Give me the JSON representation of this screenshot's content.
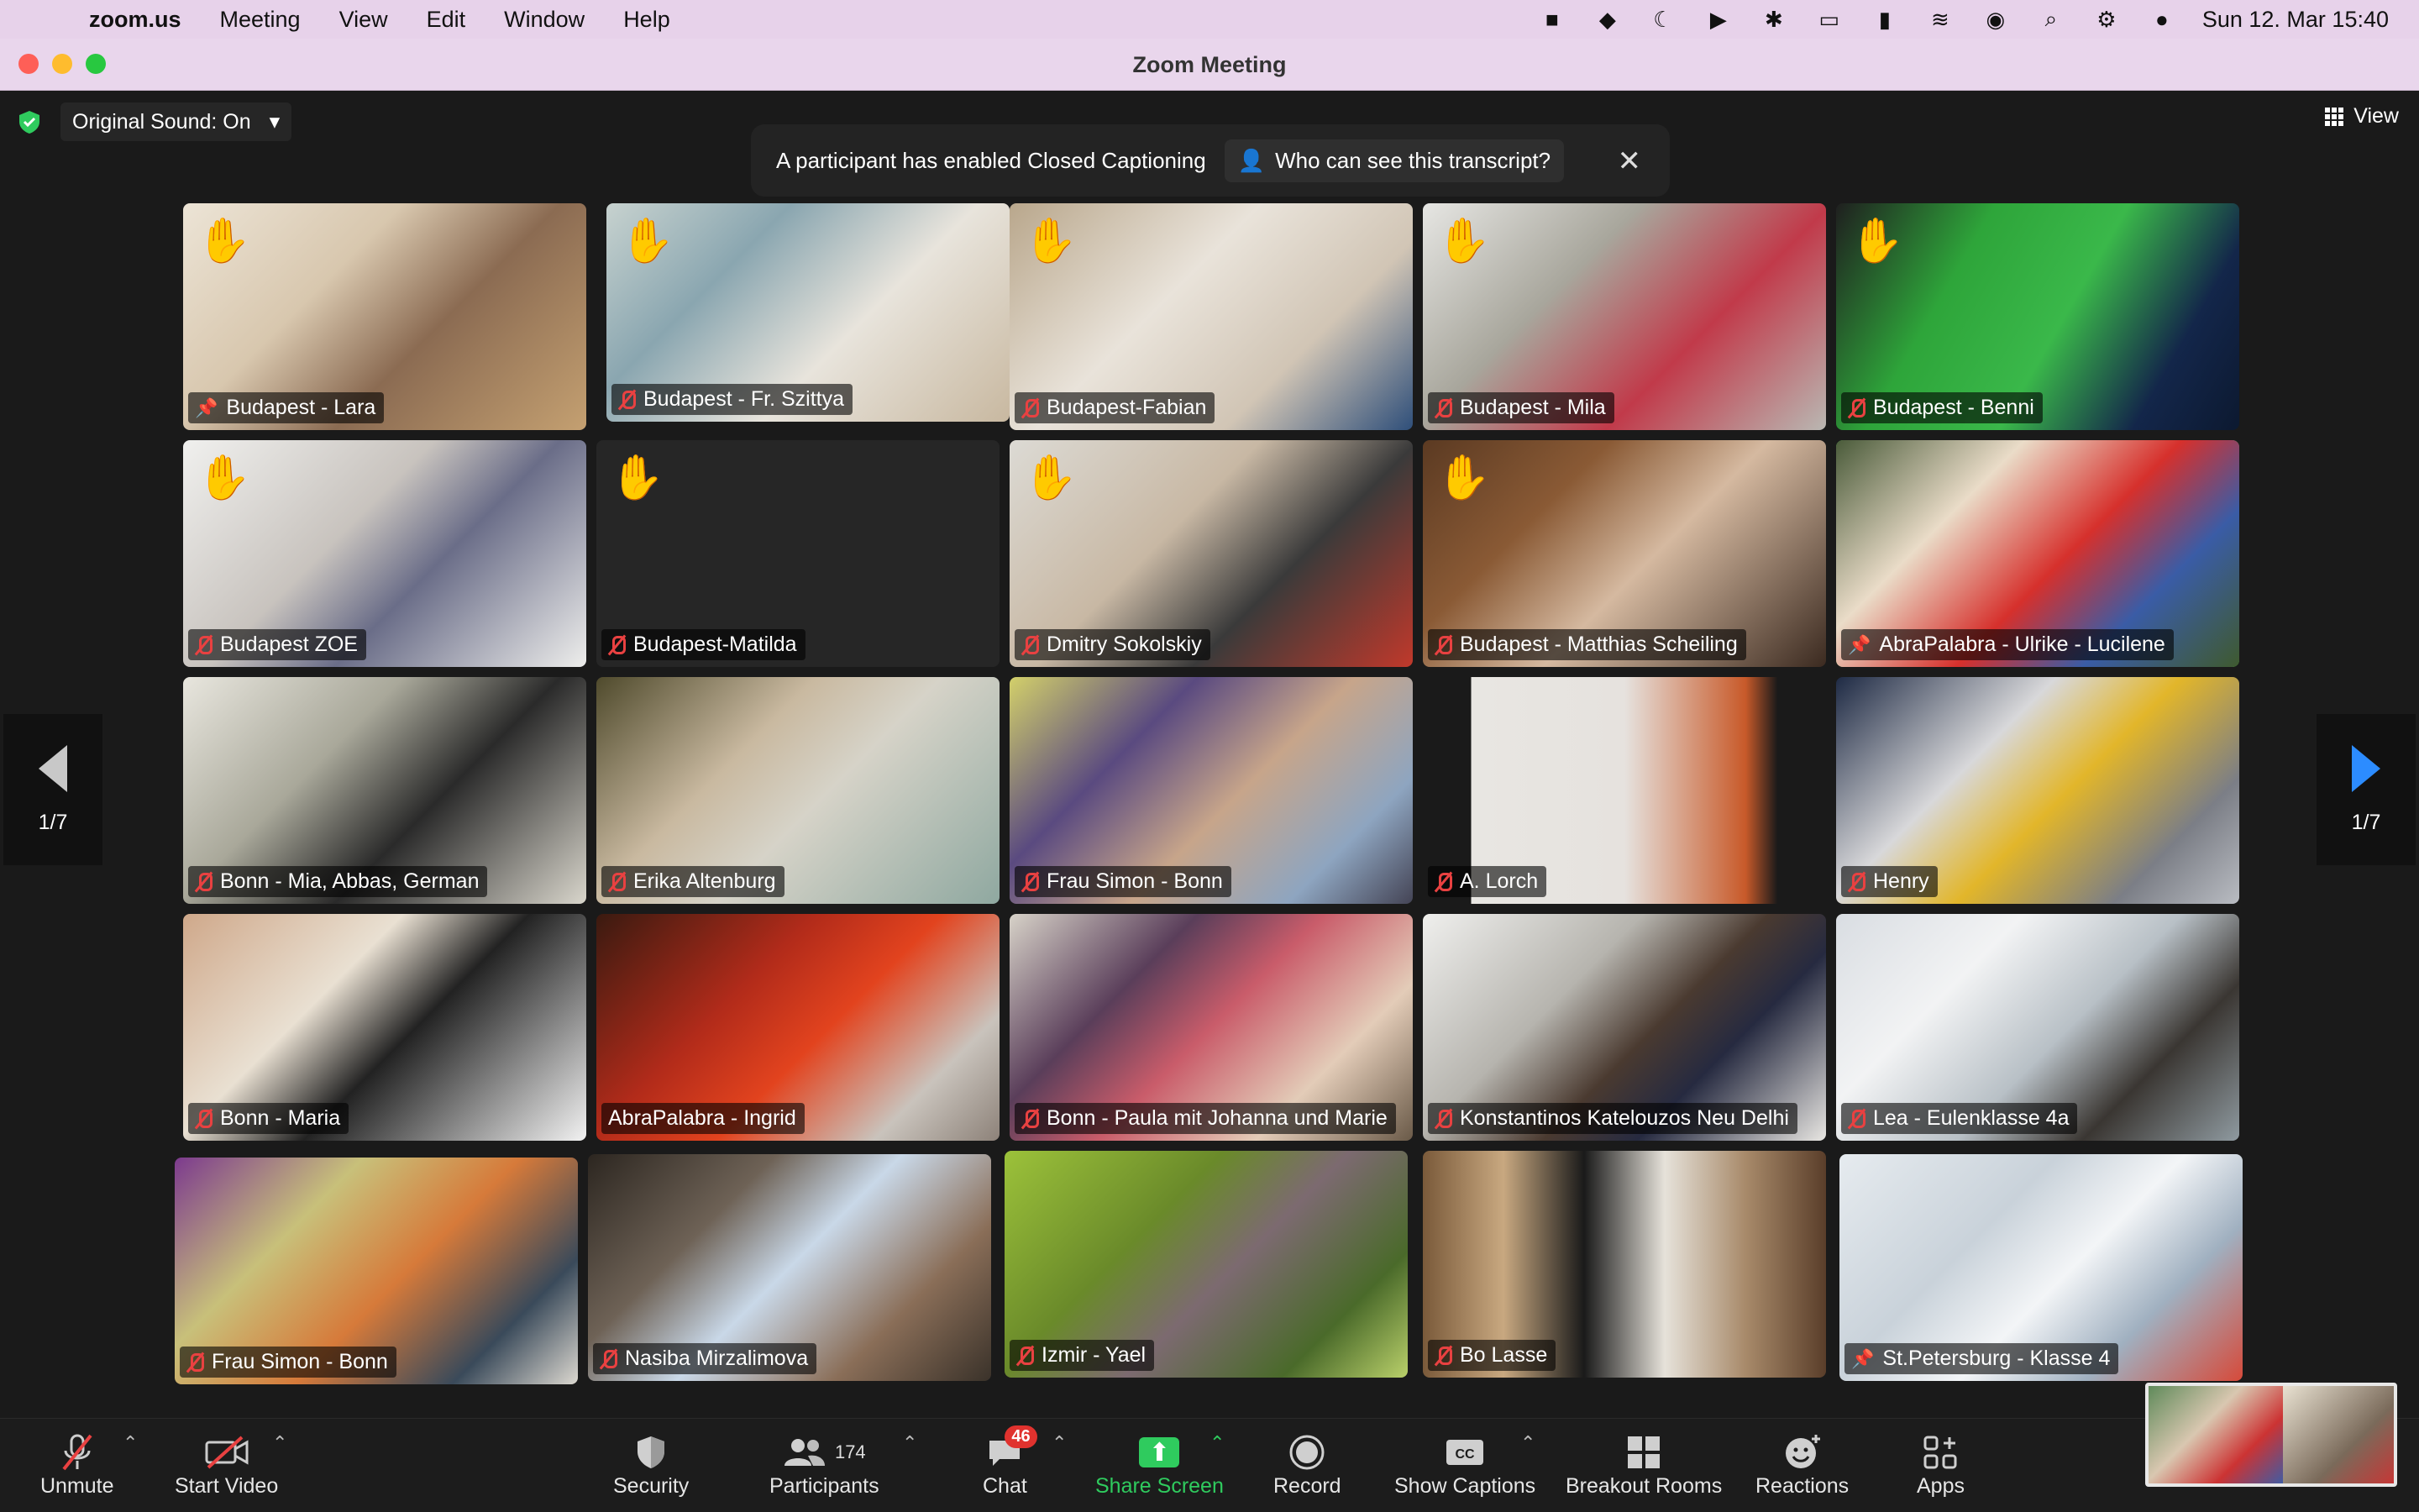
{
  "menubar": {
    "app": "zoom.us",
    "menus": [
      "Meeting",
      "View",
      "Edit",
      "Window",
      "Help"
    ],
    "clock": "Sun 12. Mar  15:40"
  },
  "window": {
    "title": "Zoom Meeting"
  },
  "meeting": {
    "original_sound": "Original Sound: On",
    "view_label": "View",
    "cc_banner": {
      "text": "A participant has enabled Closed Captioning",
      "who_label": "Who can see this transcript?"
    },
    "page_label_prev": "1/7",
    "page_label_next": "1/7",
    "tiles": [
      {
        "name": "Budapest - Lara",
        "hand": true,
        "icon": "pin"
      },
      {
        "name": "Budapest - Fr. Szittya",
        "hand": true,
        "icon": "muted"
      },
      {
        "name": "Budapest-Fabian",
        "hand": true,
        "icon": "muted"
      },
      {
        "name": "Budapest - Mila",
        "hand": true,
        "icon": "muted"
      },
      {
        "name": "Budapest - Benni",
        "hand": true,
        "icon": "muted"
      },
      {
        "name": "Budapest ZOE",
        "hand": true,
        "icon": "muted"
      },
      {
        "name": "Budapest-Matilda",
        "hand": true,
        "icon": "muted"
      },
      {
        "name": "Dmitry Sokolskiy",
        "hand": true,
        "icon": "muted"
      },
      {
        "name": "Budapest - Matthias Scheiling",
        "hand": true,
        "icon": "muted"
      },
      {
        "name": "AbraPalabra - Ulrike - Lucilene",
        "hand": false,
        "icon": "pin",
        "active": true
      },
      {
        "name": "Bonn - Mia, Abbas, German",
        "hand": false,
        "icon": "muted"
      },
      {
        "name": "Erika Altenburg",
        "hand": false,
        "icon": "muted"
      },
      {
        "name": "Frau Simon - Bonn",
        "hand": false,
        "icon": "muted"
      },
      {
        "name": "A. Lorch",
        "hand": false,
        "icon": "muted"
      },
      {
        "name": "Henry",
        "hand": false,
        "icon": "muted"
      },
      {
        "name": "Bonn - Maria",
        "hand": false,
        "icon": "muted"
      },
      {
        "name": "AbraPalabra - Ingrid",
        "hand": false,
        "icon": "none"
      },
      {
        "name": "Bonn - Paula mit Johanna und Marie",
        "hand": false,
        "icon": "muted"
      },
      {
        "name": "Konstantinos Katelouzos Neu Delhi",
        "hand": false,
        "icon": "muted"
      },
      {
        "name": "Lea - Eulenklasse 4a",
        "hand": false,
        "icon": "muted"
      },
      {
        "name": "Frau Simon - Bonn",
        "hand": false,
        "icon": "muted"
      },
      {
        "name": "Nasiba Mirzalimova",
        "hand": false,
        "icon": "muted"
      },
      {
        "name": "Izmir - Yael",
        "hand": false,
        "icon": "muted"
      },
      {
        "name": "Bo Lasse",
        "hand": false,
        "icon": "muted"
      },
      {
        "name": "St.Petersburg - Klasse 4",
        "hand": false,
        "icon": "pin"
      }
    ]
  },
  "toolbar": {
    "unmute": "Unmute",
    "start_video": "Start Video",
    "security": "Security",
    "participants": "Participants",
    "participants_count": "174",
    "chat": "Chat",
    "chat_badge": "46",
    "share_screen": "Share Screen",
    "record": "Record",
    "show_captions": "Show Captions",
    "breakout_rooms": "Breakout Rooms",
    "reactions": "Reactions",
    "apps": "Apps"
  },
  "colors": {
    "accent_green": "#2fcb5e",
    "muted_red": "#e94141",
    "next_arrow": "#2c8cff"
  }
}
